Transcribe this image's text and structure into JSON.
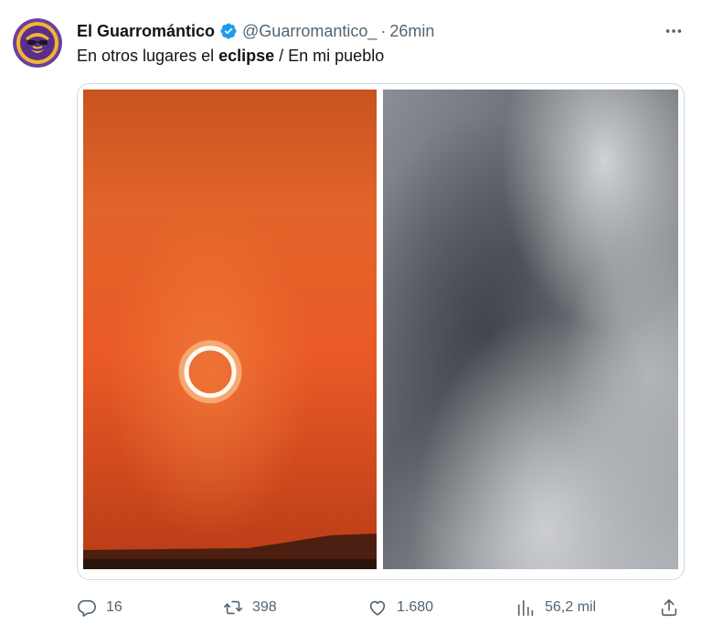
{
  "tweet": {
    "author_name": "El Guarromántico",
    "handle": "@Guarromantico_",
    "separator": "·",
    "time": "26min",
    "text_before": "En otros lugares el ",
    "text_bold": "eclipse",
    "text_after": " / En mi pueblo"
  },
  "actions": {
    "replies": "16",
    "retweets": "398",
    "likes": "1.680",
    "views": "56,2 mil"
  },
  "icons": {
    "verified": "verified-badge-icon",
    "more": "more-options-icon",
    "reply": "reply-icon",
    "retweet": "retweet-icon",
    "like": "heart-icon",
    "views": "views-chart-icon",
    "share": "share-icon"
  },
  "colors": {
    "verified": "#1d9bf0",
    "secondary_text": "#536471",
    "sunset_orange": "#e35a27",
    "sky_gray": "#6e7379"
  }
}
